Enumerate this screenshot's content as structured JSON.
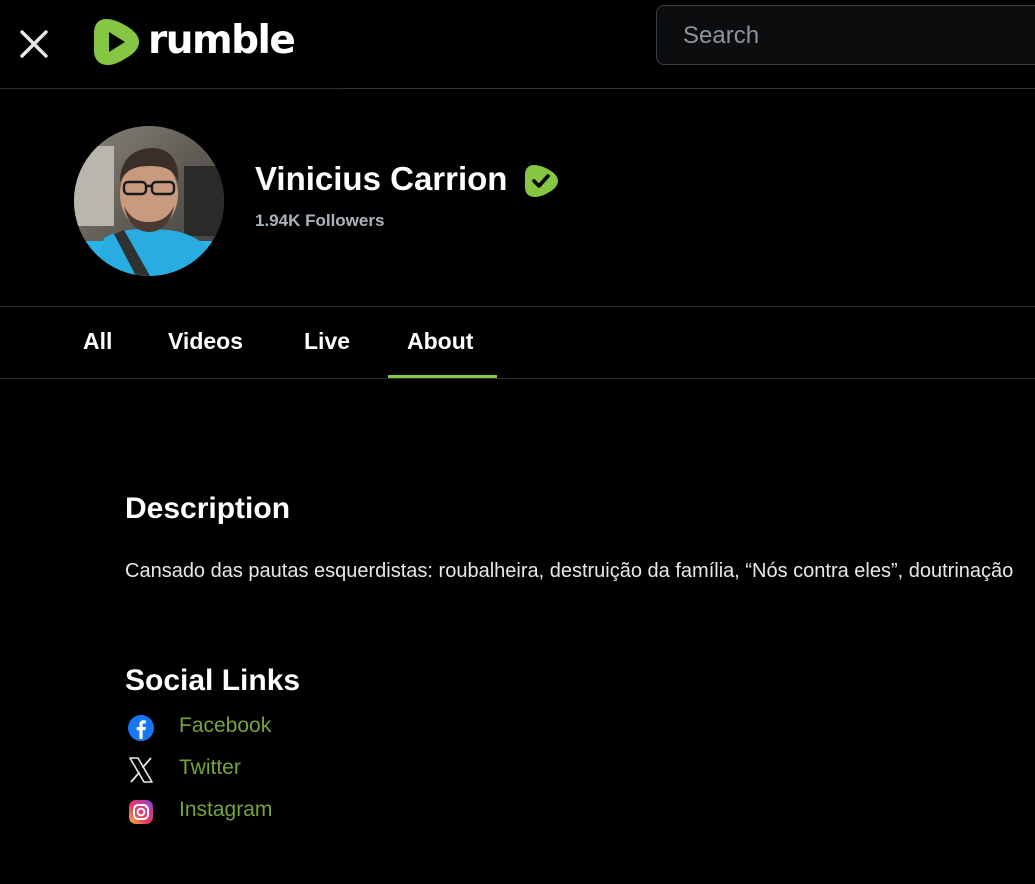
{
  "header": {
    "logo_text": "rumble",
    "search": {
      "placeholder": "Search",
      "value": ""
    },
    "brand_color": "#85c742"
  },
  "channel": {
    "name": "Vinicius Carrion",
    "followers": "1.94K Followers",
    "verified": true
  },
  "tabs": [
    {
      "label": "All",
      "active": false
    },
    {
      "label": "Videos",
      "active": false
    },
    {
      "label": "Live",
      "active": false
    },
    {
      "label": "About",
      "active": true
    }
  ],
  "about": {
    "description_title": "Description",
    "description_text": "Cansado das pautas esquerdistas: roubalheira, destruição da família, “Nós contra eles”, doutrinação",
    "social_title": "Social Links",
    "social_links": [
      {
        "label": "Facebook",
        "icon": "facebook-icon"
      },
      {
        "label": "Twitter",
        "icon": "x-twitter-icon"
      },
      {
        "label": "Instagram",
        "icon": "instagram-icon"
      }
    ]
  }
}
